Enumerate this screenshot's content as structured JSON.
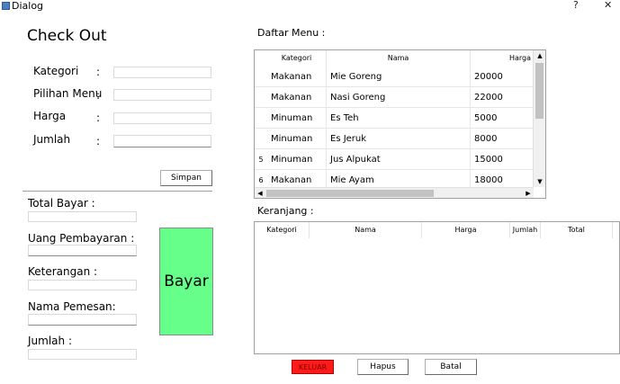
{
  "window": {
    "title": "Dialog",
    "help": "?",
    "close": "✕"
  },
  "checkout": {
    "title": "Check Out",
    "labels": {
      "kategori": "Kategori",
      "pilihan": "Pilihan Menu",
      "harga": "Harga",
      "jumlah": "Jumlah"
    },
    "colon": ":",
    "simpan": "Simpan"
  },
  "payment": {
    "total": "Total Bayar :",
    "uang": "Uang Pembayaran :",
    "keterangan": "Keterangan :",
    "nama": "Nama Pemesan:",
    "jumlah": "Jumlah :",
    "bayar": "Bayar"
  },
  "menu": {
    "title": "Daftar Menu :",
    "headers": {
      "kategori": "Kategori",
      "nama": "Nama",
      "harga": "Harga"
    },
    "rows": [
      {
        "num": "",
        "kategori": "Makanan",
        "nama": "Mie Goreng",
        "harga": "20000"
      },
      {
        "num": "",
        "kategori": "Makanan",
        "nama": "Nasi Goreng",
        "harga": "22000"
      },
      {
        "num": "",
        "kategori": "Minuman",
        "nama": "Es Teh",
        "harga": "5000"
      },
      {
        "num": "",
        "kategori": "Minuman",
        "nama": "Es Jeruk",
        "harga": "8000"
      },
      {
        "num": "5",
        "kategori": "Minuman",
        "nama": "Jus Alpukat",
        "harga": "15000"
      },
      {
        "num": "6",
        "kategori": "Makanan",
        "nama": "Mie Ayam",
        "harga": "18000"
      }
    ]
  },
  "cart": {
    "title": "Keranjang :",
    "headers": {
      "kategori": "Kategori",
      "nama": "Nama",
      "harga": "Harga",
      "jumlah": "Jumlah",
      "total": "Total"
    }
  },
  "actions": {
    "keluar": "KELUAR",
    "hapus": "Hapus",
    "batal": "Batal"
  },
  "colors": {
    "bayar": "#65ff8a",
    "keluar": "#ff1a1a"
  }
}
